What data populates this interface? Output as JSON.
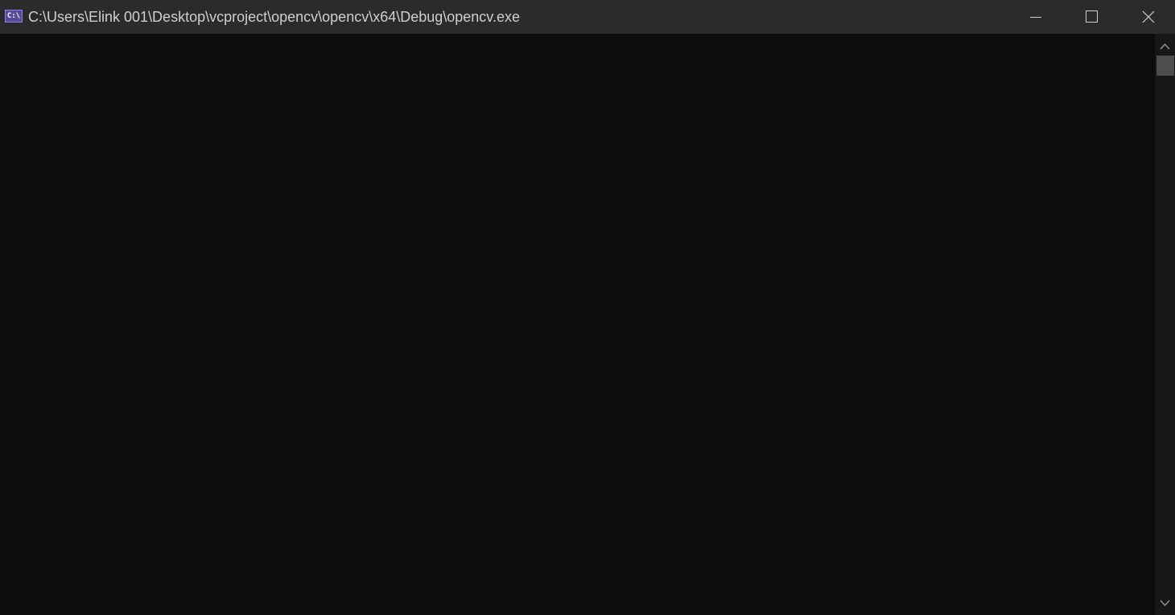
{
  "window": {
    "title": "C:\\Users\\Elink 001\\Desktop\\vcproject\\opencv\\opencv\\x64\\Debug\\opencv.exe",
    "icon": "console-app-icon",
    "icon_text": "C:\\",
    "controls": {
      "minimize": "minimize-icon",
      "maximize": "maximize-icon",
      "close": "close-icon"
    }
  },
  "console": {
    "output": ""
  },
  "scrollbar": {
    "position": 0.0
  },
  "colors": {
    "titlebar": "#2b2b2b",
    "console_bg": "#0c0c0c",
    "scrollbar_bg": "#171717",
    "scroll_thumb": "#4d4d4d",
    "icon_accent": "#5a4a9c"
  }
}
